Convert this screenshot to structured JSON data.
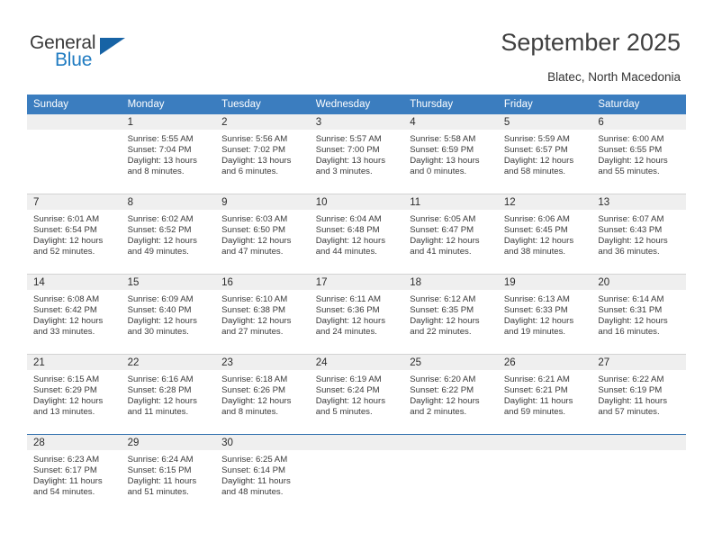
{
  "brand": {
    "name_part1": "General",
    "name_part2": "Blue",
    "triangle_color": "#1763a5",
    "blue_color": "#1f7bc1"
  },
  "header": {
    "title": "September 2025",
    "location": "Blatec, North Macedonia"
  },
  "theme": {
    "header_row_color": "#3b7dbf",
    "day_band_color": "#efefef",
    "row_divider_color": "#d3d3d3",
    "last_row_divider_color": "#2f6fad"
  },
  "weekday_headers": [
    "Sunday",
    "Monday",
    "Tuesday",
    "Wednesday",
    "Thursday",
    "Friday",
    "Saturday"
  ],
  "weeks": [
    [
      {
        "empty": true
      },
      {
        "day": "1",
        "sunrise": "Sunrise: 5:55 AM",
        "sunset": "Sunset: 7:04 PM",
        "daylight1": "Daylight: 13 hours",
        "daylight2": "and 8 minutes."
      },
      {
        "day": "2",
        "sunrise": "Sunrise: 5:56 AM",
        "sunset": "Sunset: 7:02 PM",
        "daylight1": "Daylight: 13 hours",
        "daylight2": "and 6 minutes."
      },
      {
        "day": "3",
        "sunrise": "Sunrise: 5:57 AM",
        "sunset": "Sunset: 7:00 PM",
        "daylight1": "Daylight: 13 hours",
        "daylight2": "and 3 minutes."
      },
      {
        "day": "4",
        "sunrise": "Sunrise: 5:58 AM",
        "sunset": "Sunset: 6:59 PM",
        "daylight1": "Daylight: 13 hours",
        "daylight2": "and 0 minutes."
      },
      {
        "day": "5",
        "sunrise": "Sunrise: 5:59 AM",
        "sunset": "Sunset: 6:57 PM",
        "daylight1": "Daylight: 12 hours",
        "daylight2": "and 58 minutes."
      },
      {
        "day": "6",
        "sunrise": "Sunrise: 6:00 AM",
        "sunset": "Sunset: 6:55 PM",
        "daylight1": "Daylight: 12 hours",
        "daylight2": "and 55 minutes."
      }
    ],
    [
      {
        "day": "7",
        "sunrise": "Sunrise: 6:01 AM",
        "sunset": "Sunset: 6:54 PM",
        "daylight1": "Daylight: 12 hours",
        "daylight2": "and 52 minutes."
      },
      {
        "day": "8",
        "sunrise": "Sunrise: 6:02 AM",
        "sunset": "Sunset: 6:52 PM",
        "daylight1": "Daylight: 12 hours",
        "daylight2": "and 49 minutes."
      },
      {
        "day": "9",
        "sunrise": "Sunrise: 6:03 AM",
        "sunset": "Sunset: 6:50 PM",
        "daylight1": "Daylight: 12 hours",
        "daylight2": "and 47 minutes."
      },
      {
        "day": "10",
        "sunrise": "Sunrise: 6:04 AM",
        "sunset": "Sunset: 6:48 PM",
        "daylight1": "Daylight: 12 hours",
        "daylight2": "and 44 minutes."
      },
      {
        "day": "11",
        "sunrise": "Sunrise: 6:05 AM",
        "sunset": "Sunset: 6:47 PM",
        "daylight1": "Daylight: 12 hours",
        "daylight2": "and 41 minutes."
      },
      {
        "day": "12",
        "sunrise": "Sunrise: 6:06 AM",
        "sunset": "Sunset: 6:45 PM",
        "daylight1": "Daylight: 12 hours",
        "daylight2": "and 38 minutes."
      },
      {
        "day": "13",
        "sunrise": "Sunrise: 6:07 AM",
        "sunset": "Sunset: 6:43 PM",
        "daylight1": "Daylight: 12 hours",
        "daylight2": "and 36 minutes."
      }
    ],
    [
      {
        "day": "14",
        "sunrise": "Sunrise: 6:08 AM",
        "sunset": "Sunset: 6:42 PM",
        "daylight1": "Daylight: 12 hours",
        "daylight2": "and 33 minutes."
      },
      {
        "day": "15",
        "sunrise": "Sunrise: 6:09 AM",
        "sunset": "Sunset: 6:40 PM",
        "daylight1": "Daylight: 12 hours",
        "daylight2": "and 30 minutes."
      },
      {
        "day": "16",
        "sunrise": "Sunrise: 6:10 AM",
        "sunset": "Sunset: 6:38 PM",
        "daylight1": "Daylight: 12 hours",
        "daylight2": "and 27 minutes."
      },
      {
        "day": "17",
        "sunrise": "Sunrise: 6:11 AM",
        "sunset": "Sunset: 6:36 PM",
        "daylight1": "Daylight: 12 hours",
        "daylight2": "and 24 minutes."
      },
      {
        "day": "18",
        "sunrise": "Sunrise: 6:12 AM",
        "sunset": "Sunset: 6:35 PM",
        "daylight1": "Daylight: 12 hours",
        "daylight2": "and 22 minutes."
      },
      {
        "day": "19",
        "sunrise": "Sunrise: 6:13 AM",
        "sunset": "Sunset: 6:33 PM",
        "daylight1": "Daylight: 12 hours",
        "daylight2": "and 19 minutes."
      },
      {
        "day": "20",
        "sunrise": "Sunrise: 6:14 AM",
        "sunset": "Sunset: 6:31 PM",
        "daylight1": "Daylight: 12 hours",
        "daylight2": "and 16 minutes."
      }
    ],
    [
      {
        "day": "21",
        "sunrise": "Sunrise: 6:15 AM",
        "sunset": "Sunset: 6:29 PM",
        "daylight1": "Daylight: 12 hours",
        "daylight2": "and 13 minutes."
      },
      {
        "day": "22",
        "sunrise": "Sunrise: 6:16 AM",
        "sunset": "Sunset: 6:28 PM",
        "daylight1": "Daylight: 12 hours",
        "daylight2": "and 11 minutes."
      },
      {
        "day": "23",
        "sunrise": "Sunrise: 6:18 AM",
        "sunset": "Sunset: 6:26 PM",
        "daylight1": "Daylight: 12 hours",
        "daylight2": "and 8 minutes."
      },
      {
        "day": "24",
        "sunrise": "Sunrise: 6:19 AM",
        "sunset": "Sunset: 6:24 PM",
        "daylight1": "Daylight: 12 hours",
        "daylight2": "and 5 minutes."
      },
      {
        "day": "25",
        "sunrise": "Sunrise: 6:20 AM",
        "sunset": "Sunset: 6:22 PM",
        "daylight1": "Daylight: 12 hours",
        "daylight2": "and 2 minutes."
      },
      {
        "day": "26",
        "sunrise": "Sunrise: 6:21 AM",
        "sunset": "Sunset: 6:21 PM",
        "daylight1": "Daylight: 11 hours",
        "daylight2": "and 59 minutes."
      },
      {
        "day": "27",
        "sunrise": "Sunrise: 6:22 AM",
        "sunset": "Sunset: 6:19 PM",
        "daylight1": "Daylight: 11 hours",
        "daylight2": "and 57 minutes."
      }
    ],
    [
      {
        "day": "28",
        "sunrise": "Sunrise: 6:23 AM",
        "sunset": "Sunset: 6:17 PM",
        "daylight1": "Daylight: 11 hours",
        "daylight2": "and 54 minutes."
      },
      {
        "day": "29",
        "sunrise": "Sunrise: 6:24 AM",
        "sunset": "Sunset: 6:15 PM",
        "daylight1": "Daylight: 11 hours",
        "daylight2": "and 51 minutes."
      },
      {
        "day": "30",
        "sunrise": "Sunrise: 6:25 AM",
        "sunset": "Sunset: 6:14 PM",
        "daylight1": "Daylight: 11 hours",
        "daylight2": "and 48 minutes."
      },
      {
        "empty": true
      },
      {
        "empty": true
      },
      {
        "empty": true
      },
      {
        "empty": true
      }
    ]
  ]
}
